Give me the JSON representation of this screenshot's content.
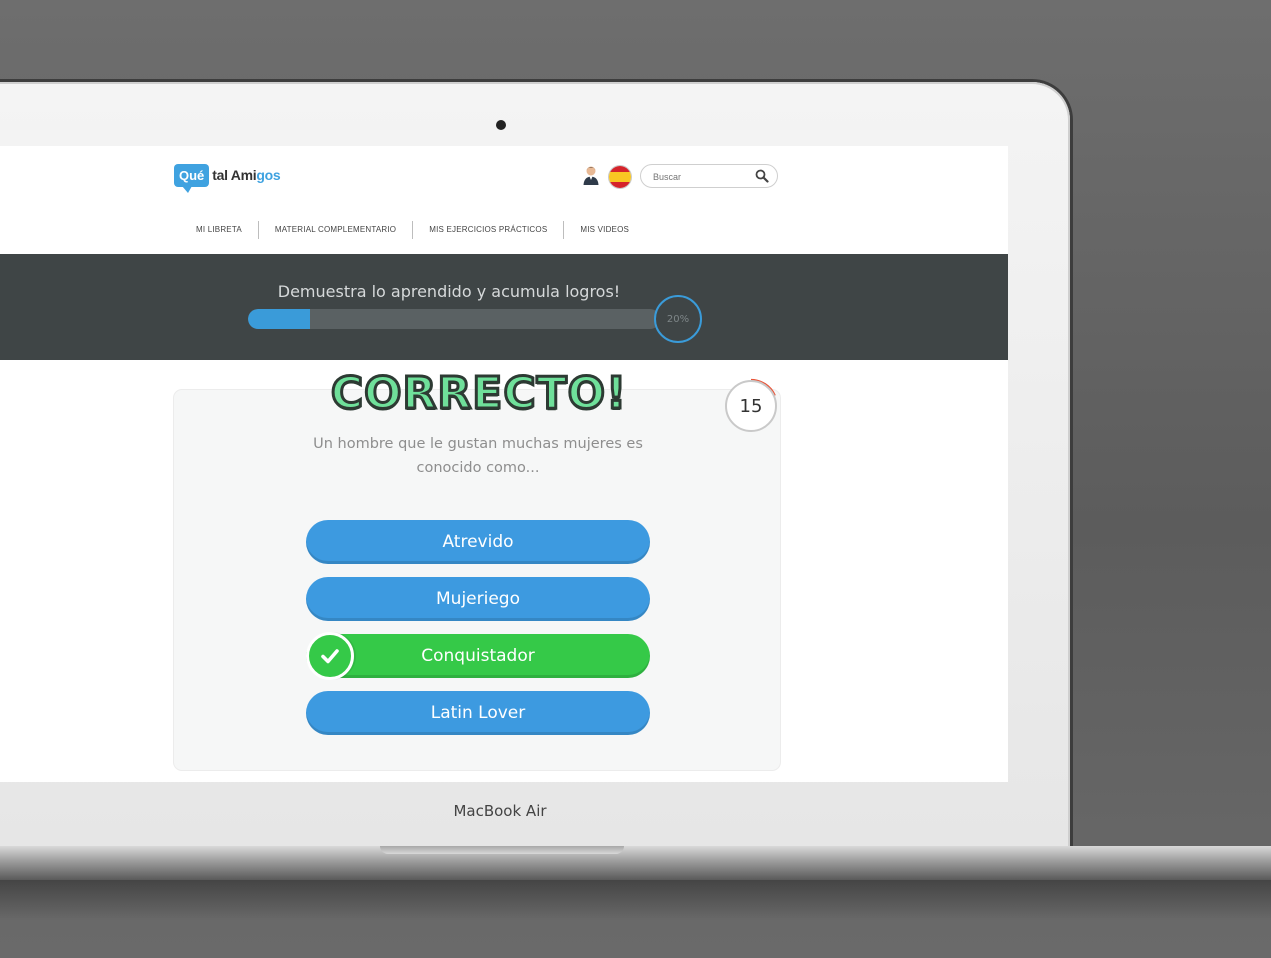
{
  "device": {
    "brand_label": "MacBook Air"
  },
  "header": {
    "logo": {
      "badge": "Qué",
      "name_prefix": "tal Ami",
      "name_highlight": "gos"
    },
    "search": {
      "placeholder": "Buscar"
    },
    "icons": {
      "user": "user-avatar-icon",
      "language": "spain-flag-icon",
      "search": "search-icon"
    }
  },
  "nav": {
    "items": [
      {
        "label": "MI LIBRETA"
      },
      {
        "label": "MATERIAL COMPLEMENTARIO"
      },
      {
        "label": "MIS EJERCICIOS PRÁCTICOS"
      },
      {
        "label": "MIS VIDEOS"
      }
    ]
  },
  "progress": {
    "title": "Demuestra lo aprendido y acumula logros!",
    "percent_label": "20%",
    "value": 0.15
  },
  "quiz": {
    "result": "CORRECTO!",
    "timer": "15",
    "question": "Un hombre que le gustan muchas mujeres es conocido como...",
    "answers": [
      {
        "label": "Atrevido",
        "state": "default"
      },
      {
        "label": "Mujeriego",
        "state": "default"
      },
      {
        "label": "Conquistador",
        "state": "correct"
      },
      {
        "label": "Latin Lover",
        "state": "default"
      }
    ]
  },
  "colors": {
    "accent_blue": "#3d9ae0",
    "correct_green": "#35c948",
    "band_dark": "#3f4546",
    "banner_green": "#6fe09a"
  }
}
